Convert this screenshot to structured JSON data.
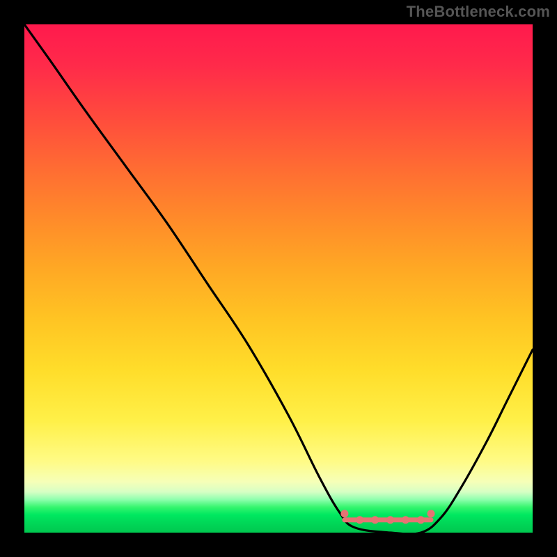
{
  "watermark": "TheBottleneck.com",
  "chart_data": {
    "type": "line",
    "title": "",
    "xlabel": "",
    "ylabel": "",
    "xlim": [
      0,
      100
    ],
    "ylim": [
      0,
      100
    ],
    "grid": false,
    "legend": false,
    "series": [
      {
        "name": "bottleneck-curve",
        "x": [
          0,
          5,
          12,
          20,
          28,
          36,
          44,
          52,
          58,
          62,
          65,
          72,
          78,
          82,
          86,
          91,
          95,
          100
        ],
        "values": [
          100,
          93,
          83,
          72,
          61,
          49,
          37,
          23,
          11,
          4,
          1,
          0,
          0,
          3,
          9,
          18,
          26,
          36
        ]
      }
    ],
    "flat_region": {
      "x_start": 63,
      "x_end": 80
    },
    "flat_markers": {
      "dot_y": 2.5,
      "dots_x": [
        63,
        66,
        69,
        72,
        75,
        78,
        80
      ],
      "color": "#e57373"
    },
    "gradient_stops": [
      {
        "pct": 0,
        "color": "#ff1a4d"
      },
      {
        "pct": 50,
        "color": "#ffb224"
      },
      {
        "pct": 80,
        "color": "#fff048"
      },
      {
        "pct": 95,
        "color": "#35f56e"
      },
      {
        "pct": 100,
        "color": "#00c84f"
      }
    ]
  }
}
